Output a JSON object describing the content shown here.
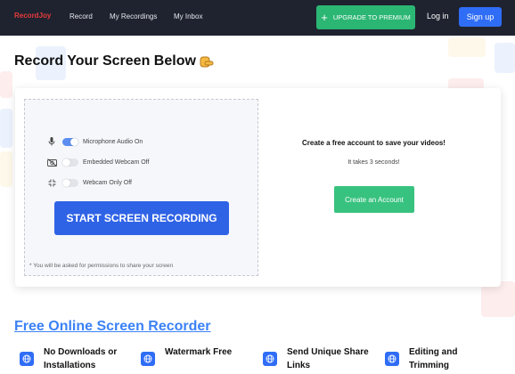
{
  "nav": {
    "brand": "RecordJoy",
    "links": [
      "Record",
      "My Recordings",
      "My Inbox"
    ],
    "premium_label": "UPGRADE TO PREMIUM",
    "login_label": "Log in",
    "signup_label": "Sign up"
  },
  "page_title": "Record Your Screen Below",
  "recorder": {
    "options": [
      {
        "label": "Microphone Audio On",
        "icon": "microphone-icon",
        "on": true
      },
      {
        "label": "Embedded Webcam Off",
        "icon": "camera-off-icon",
        "on": false
      },
      {
        "label": "Webcam Only Off",
        "icon": "minimize-icon",
        "on": false
      }
    ],
    "record_button": "START SCREEN RECORDING",
    "permission_note": "* You will be asked for permissions to share your screen"
  },
  "account": {
    "title": "Create a free account to save your videos!",
    "subtitle": "It takes 3 seconds!",
    "button": "Create an Account"
  },
  "section_title": "Free Online Screen Recorder",
  "features": [
    {
      "line1": "No Downloads or",
      "line2": "Installations"
    },
    {
      "line1": "Watermark Free",
      "line2": ""
    },
    {
      "line1": "Send Unique Share",
      "line2": "Links"
    },
    {
      "line1": "Editing and",
      "line2": "Trimming"
    }
  ],
  "colors": {
    "nav_bg": "#1f2330",
    "brand": "#e63b3b",
    "premium": "#2bb673",
    "signup": "#2f6df6",
    "record": "#2f63e6",
    "create": "#38c27f",
    "link": "#3b82f6"
  }
}
